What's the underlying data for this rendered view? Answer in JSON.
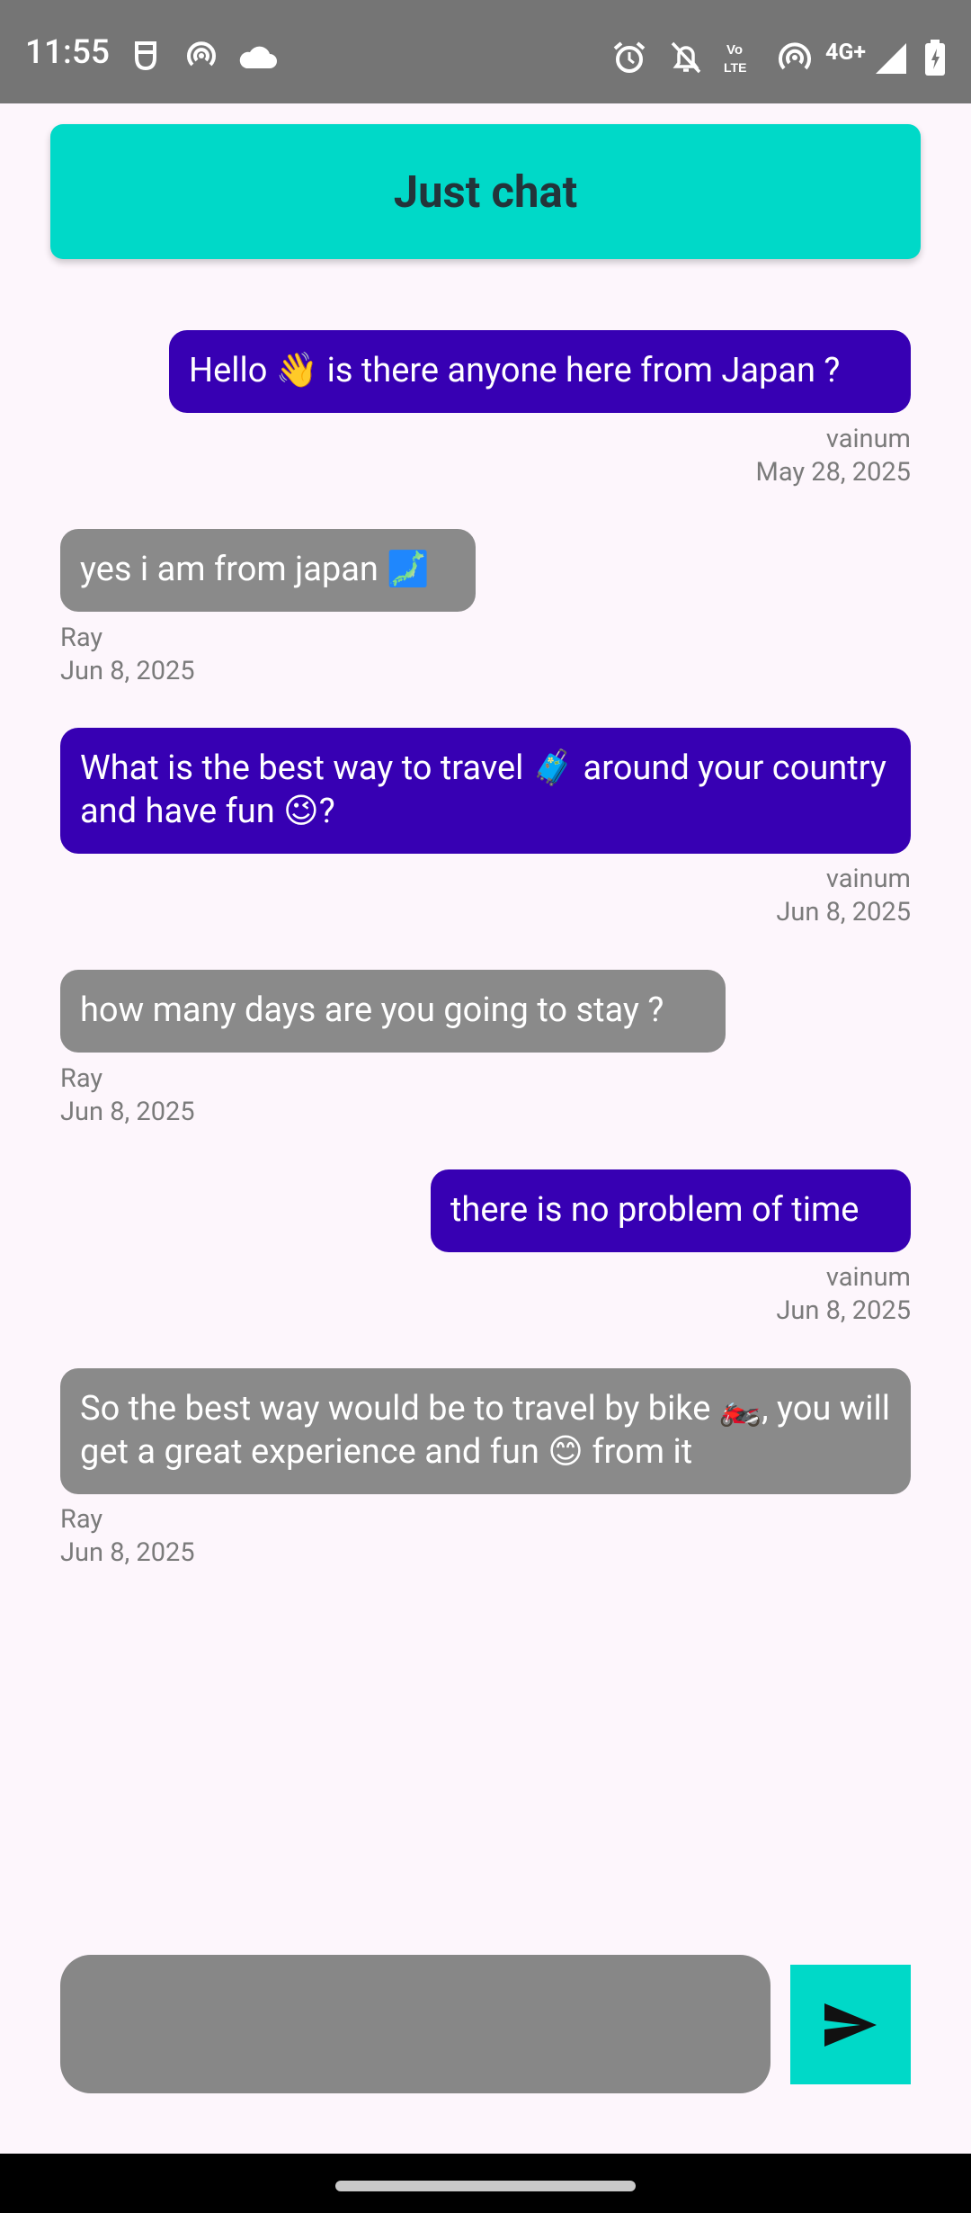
{
  "status_bar": {
    "time": "11:55",
    "network": "4G+"
  },
  "header": {
    "title": "Just chat"
  },
  "messages": [
    {
      "text": "Hello 👋 is there anyone here from Japan ?",
      "sender": "vainum",
      "date": "May 28, 2025",
      "own": true
    },
    {
      "text": "yes i am from japan 🗾",
      "sender": "Ray",
      "date": "Jun 8, 2025",
      "own": false
    },
    {
      "text": "What is the best way to travel 🧳 around your country and have fun 😉?",
      "sender": "vainum",
      "date": "Jun 8, 2025",
      "own": true
    },
    {
      "text": "how many days are you going to stay ?",
      "sender": "Ray",
      "date": "Jun 8, 2025",
      "own": false
    },
    {
      "text": "there is no problem of time",
      "sender": "vainum",
      "date": "Jun 8, 2025",
      "own": true
    },
    {
      "text": "So the best way would be to travel by bike 🏍️, you will get a great experience and fun 😊 from it",
      "sender": "Ray",
      "date": "Jun 8, 2025",
      "own": false
    }
  ],
  "composer": {
    "placeholder": "",
    "send_icon": "send-icon"
  },
  "colors": {
    "accent": "#00d9c8",
    "own_bubble": "#3700b3",
    "other_bubble": "#8a8a8a",
    "background": "#fdf6fc"
  }
}
